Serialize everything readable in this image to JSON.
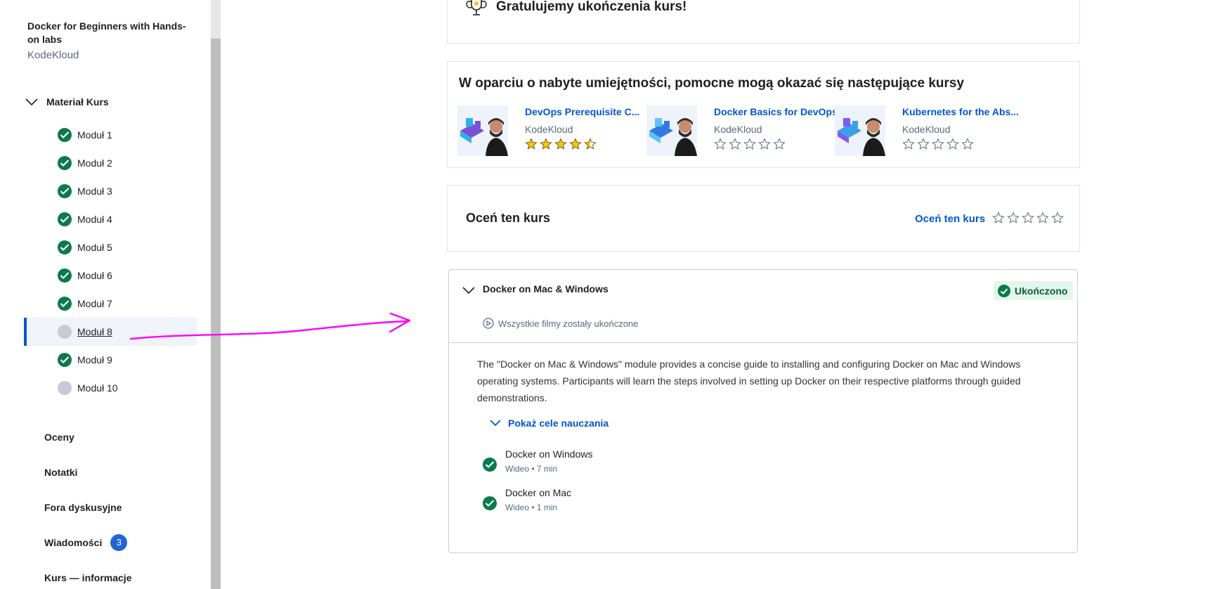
{
  "sidebar": {
    "course_title": "Docker for Beginners with Hands-on labs",
    "provider": "KodeKloud",
    "section_label": "Materiał Kurs",
    "modules": [
      {
        "label": "Moduł 1",
        "completed": true
      },
      {
        "label": "Moduł 2",
        "completed": true
      },
      {
        "label": "Moduł 3",
        "completed": true
      },
      {
        "label": "Moduł 4",
        "completed": true
      },
      {
        "label": "Moduł 5",
        "completed": true
      },
      {
        "label": "Moduł 6",
        "completed": true
      },
      {
        "label": "Moduł 7",
        "completed": true
      },
      {
        "label": "Moduł 8",
        "completed": false,
        "active": true
      },
      {
        "label": "Moduł 9",
        "completed": true
      },
      {
        "label": "Moduł 10",
        "completed": false
      }
    ],
    "links": [
      {
        "label": "Oceny"
      },
      {
        "label": "Notatki"
      },
      {
        "label": "Fora dyskusyjne"
      },
      {
        "label": "Wiadomości",
        "badge": "3"
      },
      {
        "label": "Kurs — informacje"
      }
    ]
  },
  "congrats": {
    "text": "Gratulujemy ukończenia kurs!"
  },
  "recommendations": {
    "title": "W oparciu o nabyte umiejętności, pomocne mogą okazać się następujące kursy",
    "items": [
      {
        "name": "DevOps Prerequisite C...",
        "provider": "KodeKloud",
        "rating": 4.5
      },
      {
        "name": "Docker Basics for DevOps",
        "provider": "KodeKloud",
        "rating": 0
      },
      {
        "name": "Kubernetes for the Abs...",
        "provider": "KodeKloud",
        "rating": 0
      }
    ]
  },
  "rate_course": {
    "title": "Oceń ten kurs",
    "link": "Oceń ten kurs",
    "stars": 0
  },
  "module_card": {
    "title": "Docker on Mac & Windows",
    "status_pill": "Ukończono",
    "status_line": "Wszystkie filmy zostały ukończone",
    "description": "The \"Docker on Mac & Windows\" module provides a concise guide to installing and configuring Docker on Mac and Windows operating systems. Participants will learn the steps involved in setting up Docker on their respective platforms through guided demonstrations.",
    "show_goals": "Pokaż cele nauczania",
    "items": [
      {
        "name": "Docker on Windows",
        "meta": "Wideo • 7 min"
      },
      {
        "name": "Docker on Mac",
        "meta": "Wideo • 1 min"
      }
    ]
  },
  "colors": {
    "accent": "#0056d2",
    "success": "#0a7a4a",
    "annotation": "#ff00ff"
  }
}
